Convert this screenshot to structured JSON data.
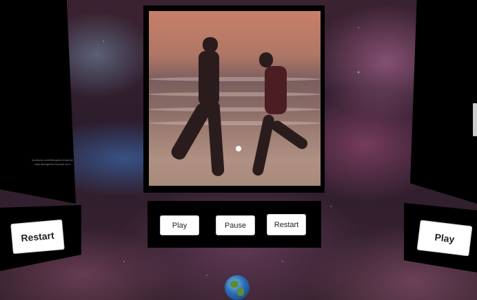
{
  "left_panel": {
    "credit_lines": [
      "facebook.com/BeingretroChannel",
      "www.BeingretroChannel.com"
    ],
    "restart_label": "Restart"
  },
  "video_panel": {
    "play_label": "Play",
    "pause_label": "Pause",
    "restart_label": "Restart"
  },
  "right_panel": {
    "play_label": "Play"
  }
}
